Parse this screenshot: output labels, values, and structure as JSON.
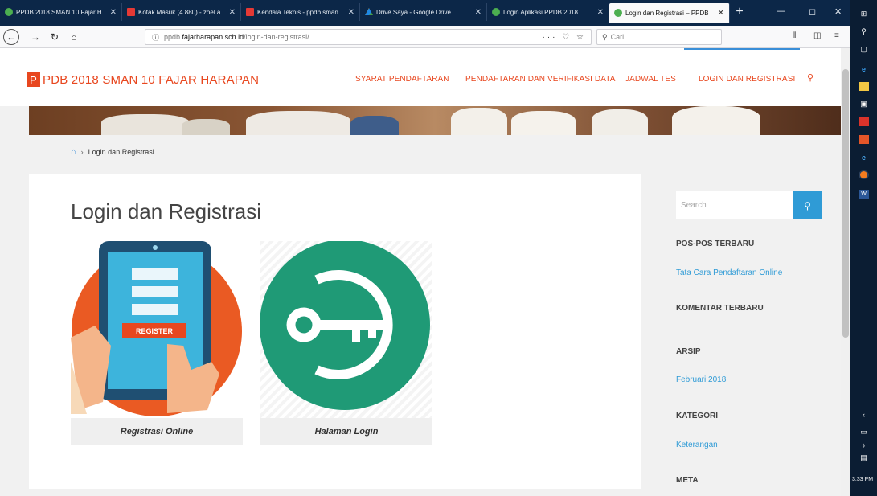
{
  "browser": {
    "tabs": [
      {
        "label": "PPDB 2018 SMAN 10 Fajar H",
        "favicon_color": "#4caf50",
        "active": false
      },
      {
        "label": "Kotak Masuk (4.880) - zoel.a",
        "favicon_color": "#e53935",
        "active": false
      },
      {
        "label": "Kendala Teknis - ppdb.sman",
        "favicon_color": "#e53935",
        "active": false
      },
      {
        "label": "Drive Saya - Google Drive",
        "favicon_color": "#fbc02d",
        "active": false
      },
      {
        "label": "Login Aplikasi PPDB 2018",
        "favicon_color": "#4caf50",
        "active": false
      },
      {
        "label": "Login dan Registrasi – PPDB",
        "favicon_color": "#4caf50",
        "active": true
      }
    ],
    "new_tab": "+",
    "url_prefix": "ppdb.",
    "url_host": "fajarharapan.sch.id",
    "url_path": "/login-dan-registrasi/",
    "url_actions": "··· ♡ ☆",
    "search_placeholder": "Cari"
  },
  "site": {
    "logo_letter": "P",
    "logo_text": "PDB 2018 SMAN 10 FAJAR HARAPAN",
    "menu": [
      {
        "label": "SYARAT PENDAFTARAN"
      },
      {
        "label": "PENDAFTARAN DAN VERIFIKASI DATA"
      },
      {
        "label": "JADWAL TES"
      },
      {
        "label": "LOGIN DAN REGISTRASI"
      }
    ],
    "accent": "#e8471f",
    "link_color": "#2f9bd6"
  },
  "breadcrumb": {
    "current": "Login dan Registrasi"
  },
  "main": {
    "title": "Login dan Registrasi",
    "cards": [
      {
        "caption": "Registrasi Online",
        "button_text": "REGISTER"
      },
      {
        "caption": "Halaman Login"
      }
    ]
  },
  "sidebar": {
    "search_placeholder": "Search",
    "recent_posts_heading": "POS-POS TERBARU",
    "recent_posts": [
      "Tata Cara Pendaftaran Online"
    ],
    "recent_comments_heading": "KOMENTAR TERBARU",
    "archive_heading": "ARSIP",
    "archive": [
      "Februari 2018"
    ],
    "category_heading": "KATEGORI",
    "categories": [
      "Keterangan"
    ],
    "meta_heading": "META"
  },
  "taskbar": {
    "time": "3:33 PM"
  }
}
